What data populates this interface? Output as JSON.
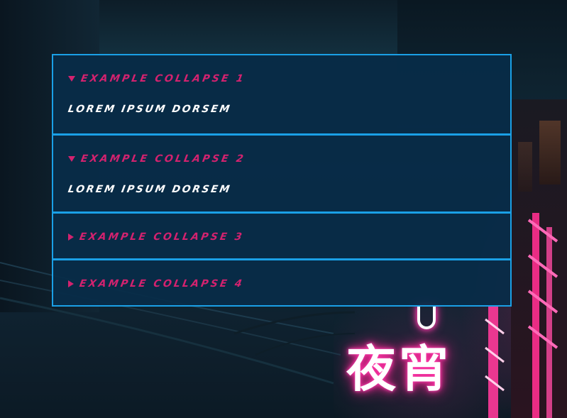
{
  "accordion": {
    "panels": [
      {
        "title": "Example Collapse 1",
        "open": true,
        "content": "Lorem ipsum dorsem"
      },
      {
        "title": "Example Collapse 2",
        "open": true,
        "content": "Lorem ipsum dorsem"
      },
      {
        "title": "Example Collapse 3",
        "open": false
      },
      {
        "title": "Example Collapse 4",
        "open": false
      }
    ]
  },
  "background": {
    "neon_sign": "夜宵"
  },
  "colors": {
    "panel_border": "#1aa0e6",
    "panel_background": "#072c48",
    "title_accent": "#d3226f",
    "content_text": "#ffffff"
  },
  "icons": {
    "expanded": "caret-down-icon",
    "collapsed": "caret-right-icon"
  }
}
